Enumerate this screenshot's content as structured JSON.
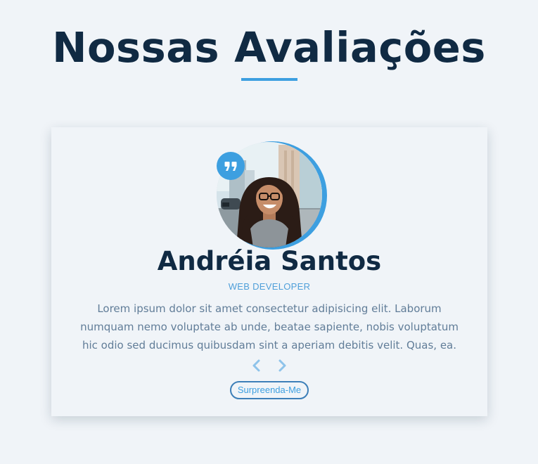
{
  "section": {
    "title": "Nossas Avaliações"
  },
  "review": {
    "name": "Andréia Santos",
    "job": "WEB DEVELOPER",
    "text": "Lorem ipsum dolor sit amet consectetur adipisicing elit. Laborum numquam nemo voluptate ab unde, beatae sapiente, nobis voluptatum hic odio sed ducimus quibusdam sint a aperiam debitis velit. Quas, ea."
  },
  "controls": {
    "prev_icon": "chevron-left-icon",
    "next_icon": "chevron-right-icon",
    "random_label": "Surpreenda-Me"
  },
  "icons": {
    "quote_icon": "quote-icon",
    "photo": "person-photo"
  },
  "colors": {
    "background": "#f0f4f8",
    "heading": "#102a43",
    "accent": "#3d9fe0",
    "body_text": "#617d98",
    "button_border": "#3d7fb8"
  }
}
